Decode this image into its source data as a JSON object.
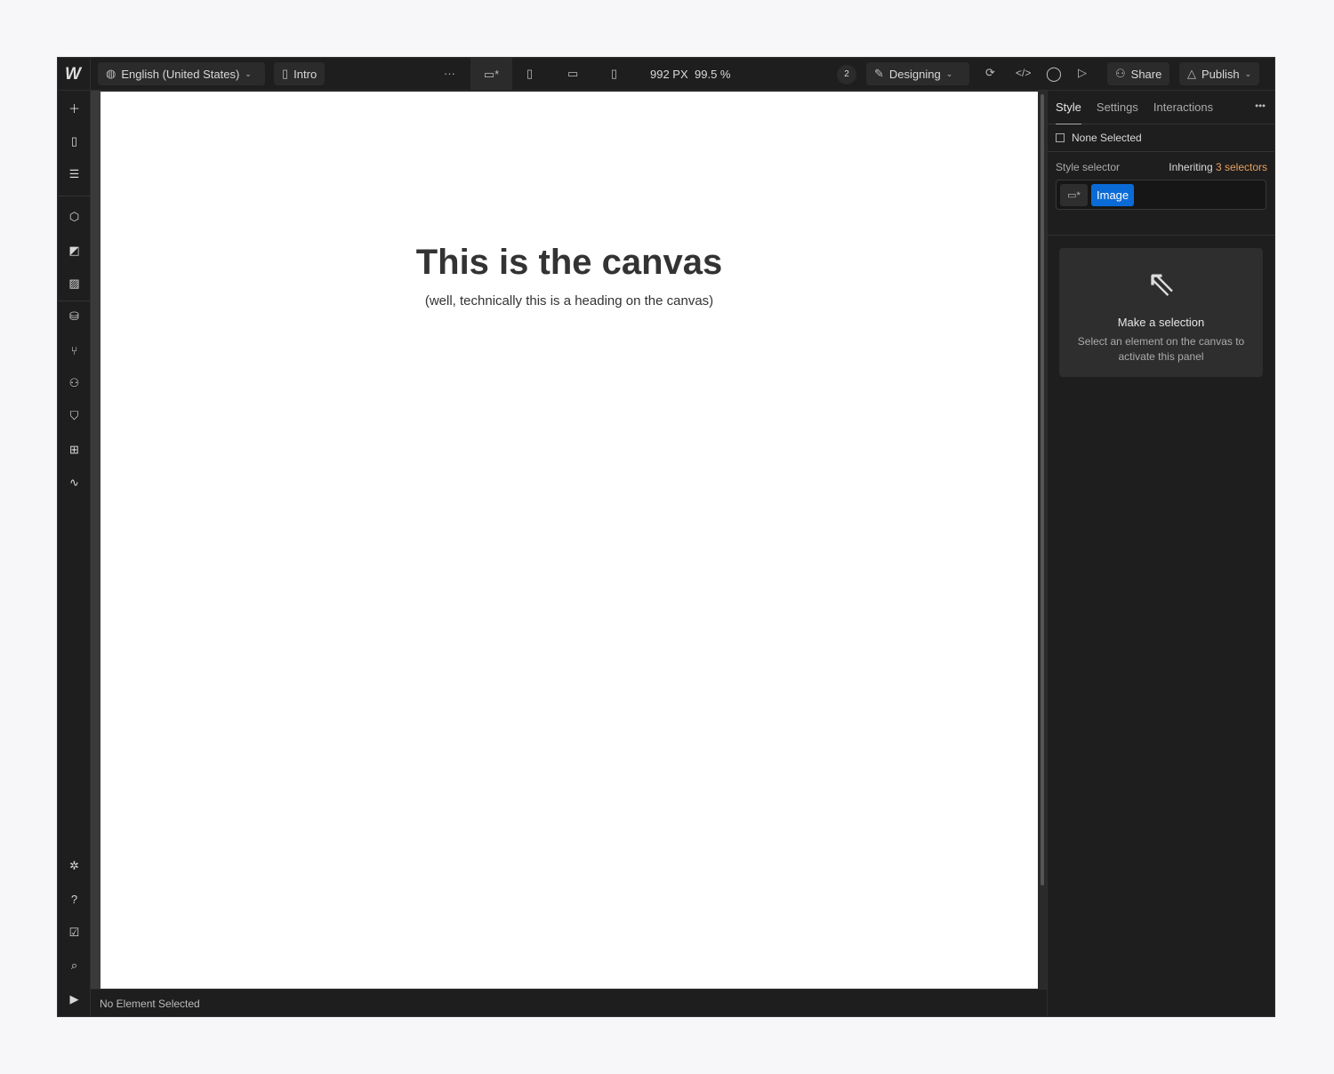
{
  "topbar": {
    "logo": "W",
    "locale": "English (United States)",
    "page": "Intro",
    "more": "···",
    "width": "992 PX",
    "zoom": "99.5 %",
    "collaborators": "2",
    "mode": "Designing",
    "share": "Share",
    "publish": "Publish"
  },
  "canvas": {
    "heading": "This is the canvas",
    "subheading": "(well, technically this is a heading on the canvas)"
  },
  "status": "No Element Selected",
  "panel": {
    "tabs": [
      "Style",
      "Settings",
      "Interactions"
    ],
    "none_selected": "None Selected",
    "style_selector": "Style selector",
    "inheriting": "Inheriting",
    "selectors": "3 selectors",
    "tag": "Image",
    "empty_title": "Make a selection",
    "empty_text": "Select an element on the canvas to activate this panel"
  },
  "colors": {
    "accent": "#0b6bd6",
    "selectors": "#e8a060"
  }
}
